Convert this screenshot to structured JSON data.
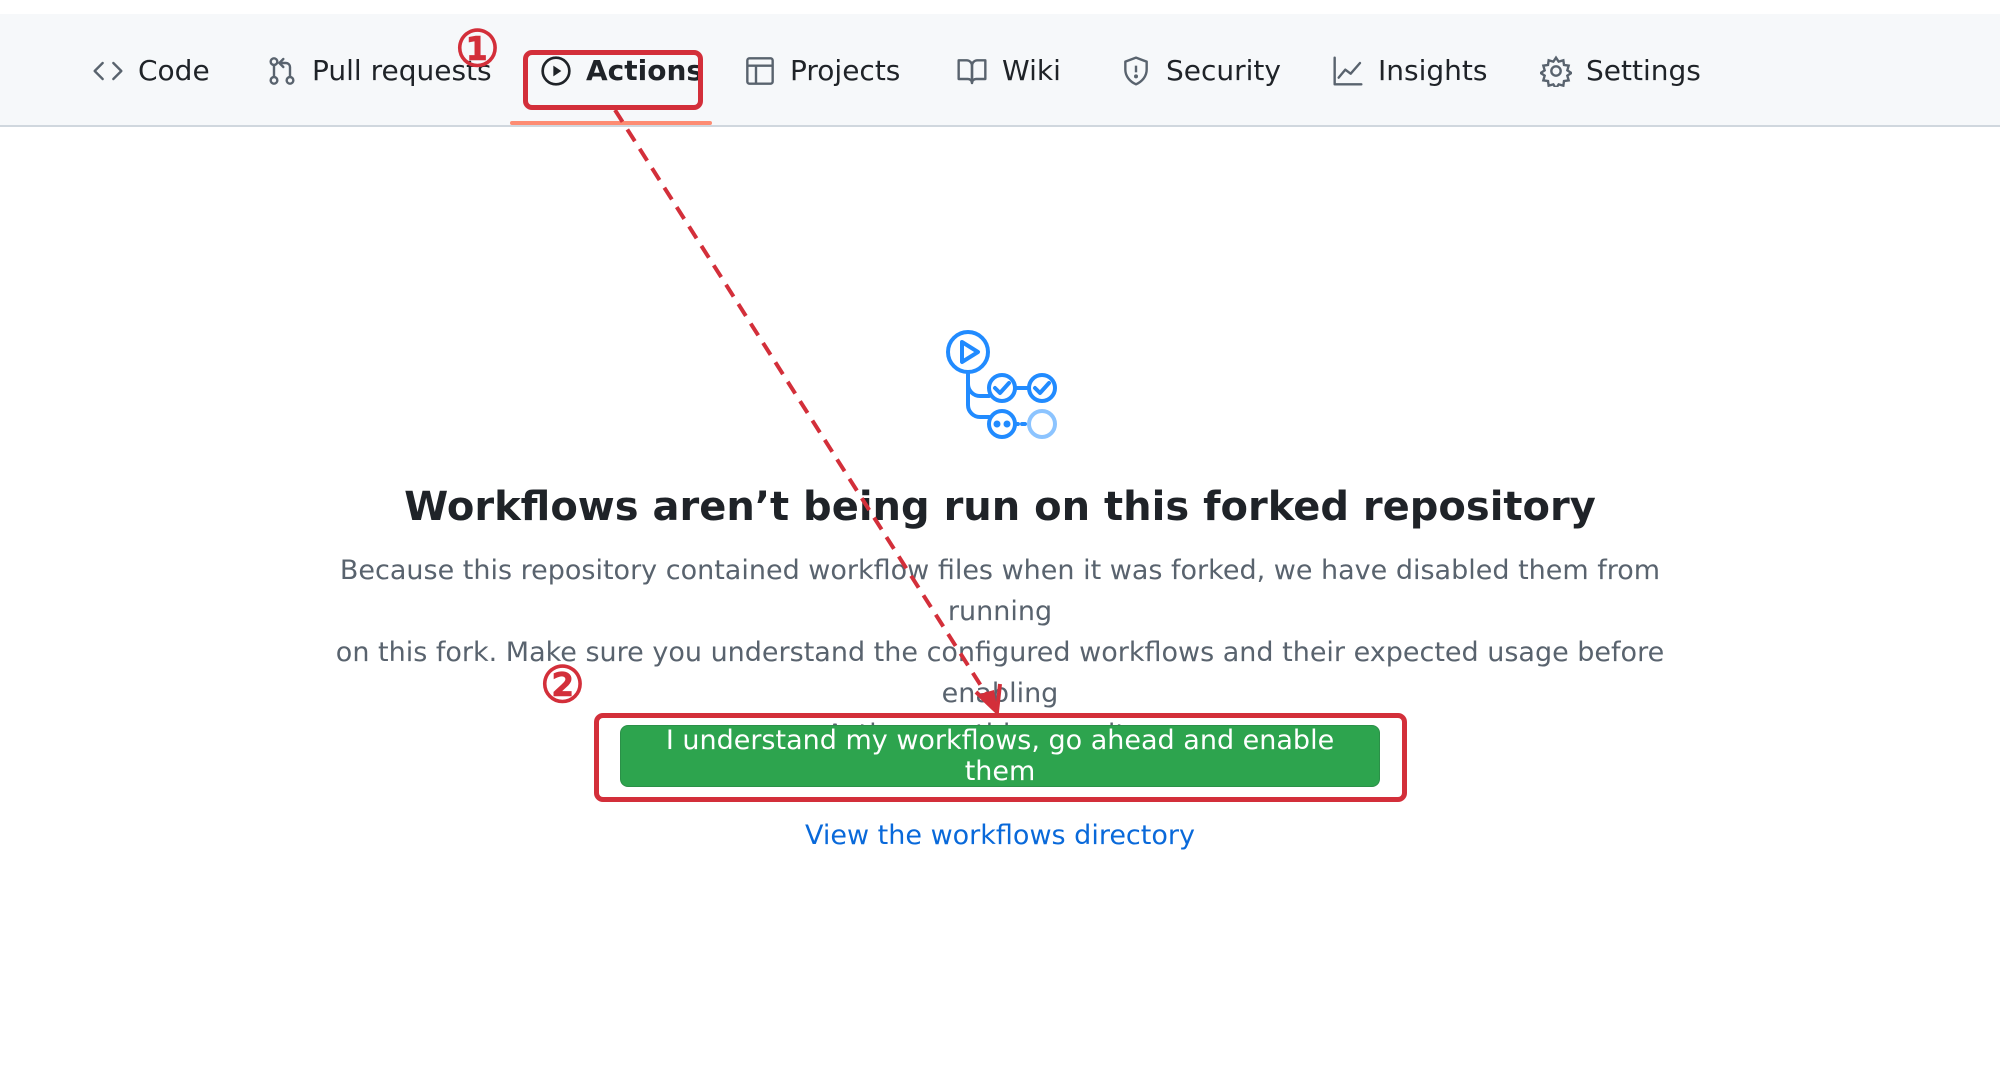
{
  "tabs": [
    {
      "label": "Code",
      "icon": "code-icon"
    },
    {
      "label": "Pull requests",
      "icon": "git-pull-request-icon"
    },
    {
      "label": "Actions",
      "icon": "play-circle-icon",
      "active": true
    },
    {
      "label": "Projects",
      "icon": "table-icon"
    },
    {
      "label": "Wiki",
      "icon": "book-icon"
    },
    {
      "label": "Security",
      "icon": "shield-icon"
    },
    {
      "label": "Insights",
      "icon": "graph-icon"
    },
    {
      "label": "Settings",
      "icon": "gear-icon"
    }
  ],
  "annotations": {
    "step1": "①",
    "step2": "②"
  },
  "main": {
    "heading": "Workflows aren’t being run on this forked repository",
    "desc_line1": "Because this repository contained workflow files when it was forked, we have disabled them from running",
    "desc_line2": "on this fork. Make sure you understand the configured workflows and their expected usage before enabling",
    "desc_line3": "Actions on this repository.",
    "enable_button": "I understand my workflows, go ahead and enable them",
    "view_link": "View the workflows directory"
  },
  "colors": {
    "accent_tab_underline": "#fd8c73",
    "annotation_red": "#d32f3a",
    "button_green": "#2da44e",
    "link_blue": "#0969da"
  }
}
